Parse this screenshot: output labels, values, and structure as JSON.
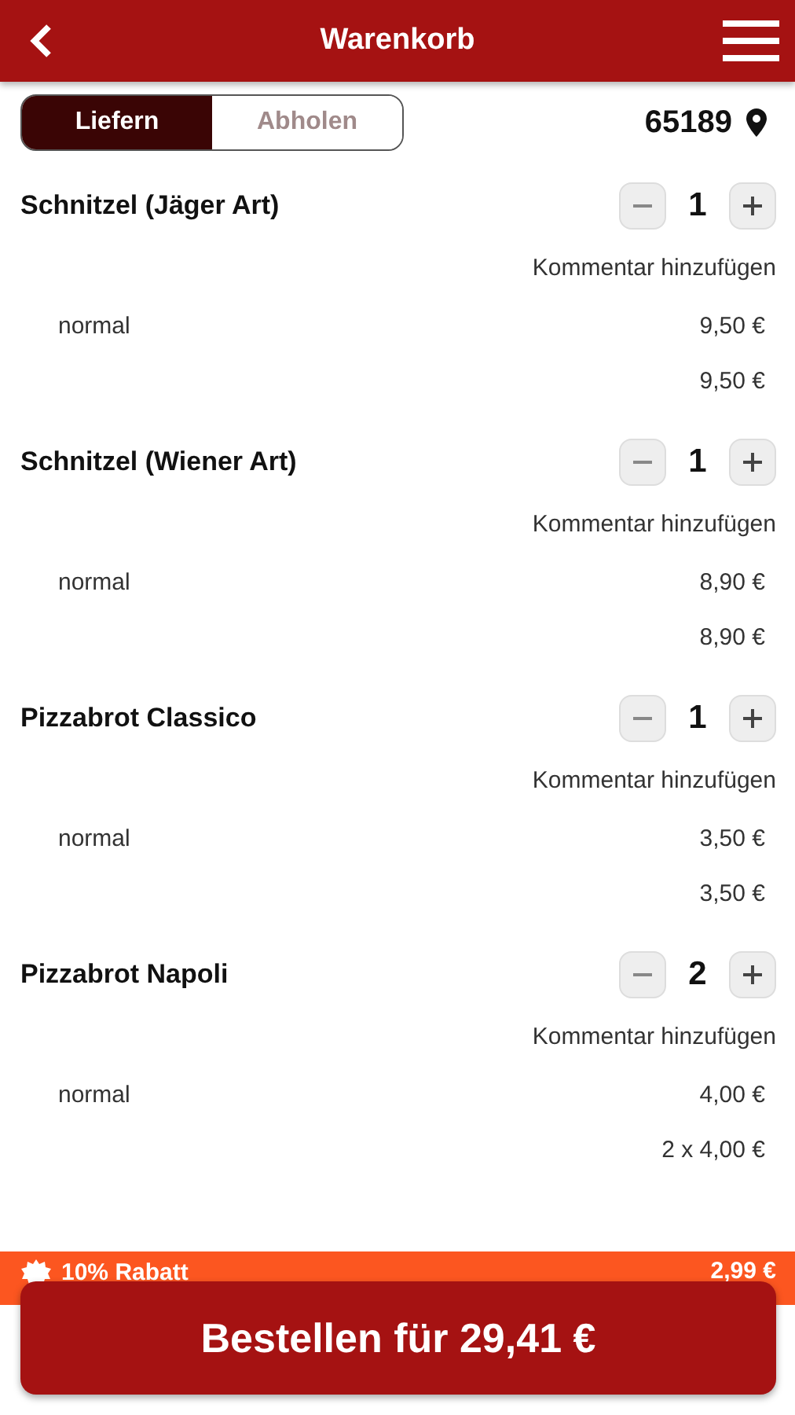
{
  "header": {
    "title": "Warenkorb"
  },
  "modes": [
    {
      "label": "Liefern",
      "selected": true
    },
    {
      "label": "Abholen",
      "selected": false
    }
  ],
  "postcode": "65189",
  "items": [
    {
      "name": "Schnitzel (Jäger Art)",
      "quantity": "1",
      "comment_link": "Kommentar hinzufügen",
      "variant": "normal",
      "unit_price": "9,50 €",
      "total": "9,50 €"
    },
    {
      "name": "Schnitzel (Wiener Art)",
      "quantity": "1",
      "comment_link": "Kommentar hinzufügen",
      "variant": "normal",
      "unit_price": "8,90 €",
      "total": "8,90 €"
    },
    {
      "name": "Pizzabrot Classico",
      "quantity": "1",
      "comment_link": "Kommentar hinzufügen",
      "variant": "normal",
      "unit_price": "3,50 €",
      "total": "3,50 €"
    },
    {
      "name": "Pizzabrot Napoli",
      "quantity": "2",
      "comment_link": "Kommentar hinzufügen",
      "variant": "normal",
      "unit_price": "4,00 €",
      "total": "2 x 4,00 €"
    }
  ],
  "discount": {
    "label": "10% Rabatt",
    "amount": "2,99 €"
  },
  "order_button": "Bestellen für 29,41 €"
}
